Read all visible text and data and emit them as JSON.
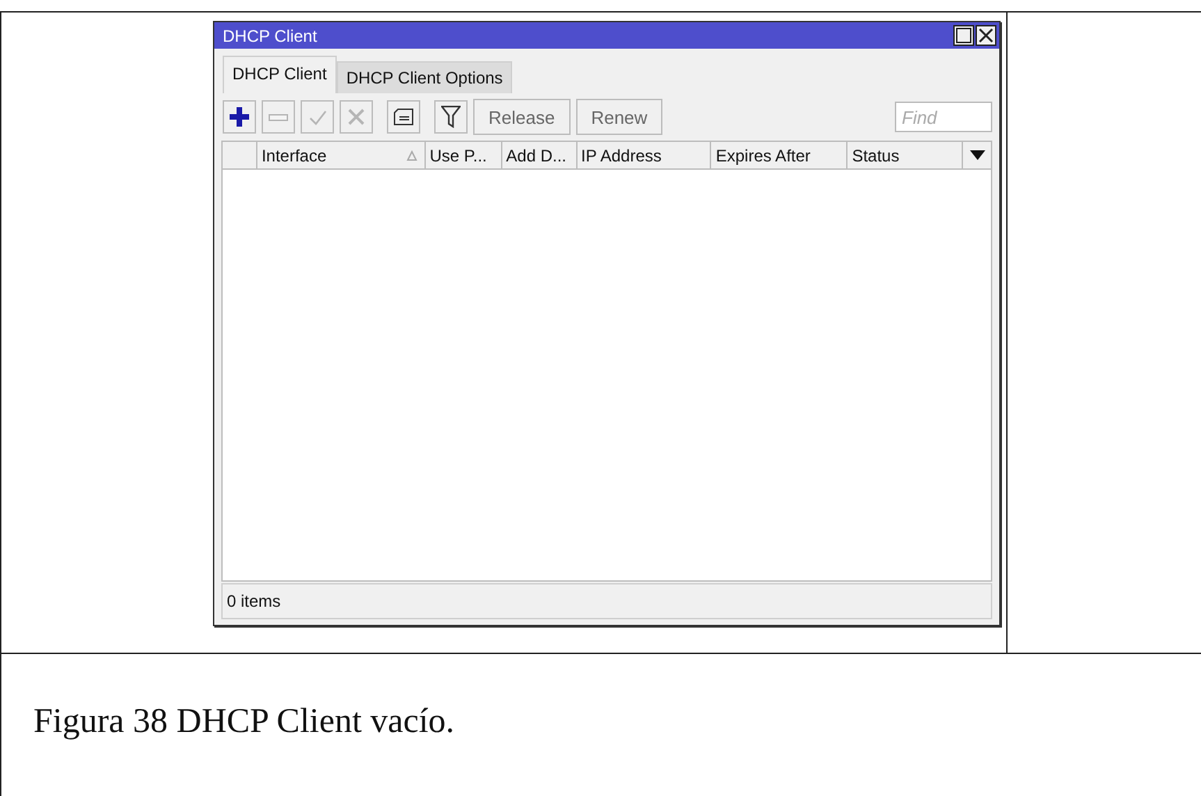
{
  "window": {
    "title": "DHCP Client"
  },
  "tabs": [
    {
      "label": "DHCP Client",
      "selected": true
    },
    {
      "label": "DHCP Client Options",
      "selected": false
    }
  ],
  "toolbar": {
    "icon_buttons": [
      {
        "kind": "add",
        "disabled": false
      },
      {
        "kind": "remove",
        "disabled": true
      },
      {
        "kind": "enable",
        "disabled": true
      },
      {
        "kind": "disable",
        "disabled": true
      },
      {
        "kind": "comment",
        "disabled": false
      },
      {
        "kind": "filter",
        "disabled": false
      }
    ],
    "buttons": [
      "Release",
      "Renew"
    ],
    "search": {
      "placeholder": "Find"
    }
  },
  "table": {
    "columns": [
      {
        "label": "Interface",
        "sorted": true
      },
      {
        "label": "Use P...",
        "sorted": false
      },
      {
        "label": "Add D...",
        "sorted": false
      },
      {
        "label": "IP Address",
        "sorted": false
      },
      {
        "label": "Expires After",
        "sorted": false
      },
      {
        "label": "Status",
        "sorted": false
      }
    ]
  },
  "status_bar": "0 items",
  "caption": "Figura 38 DHCP Client vacío."
}
